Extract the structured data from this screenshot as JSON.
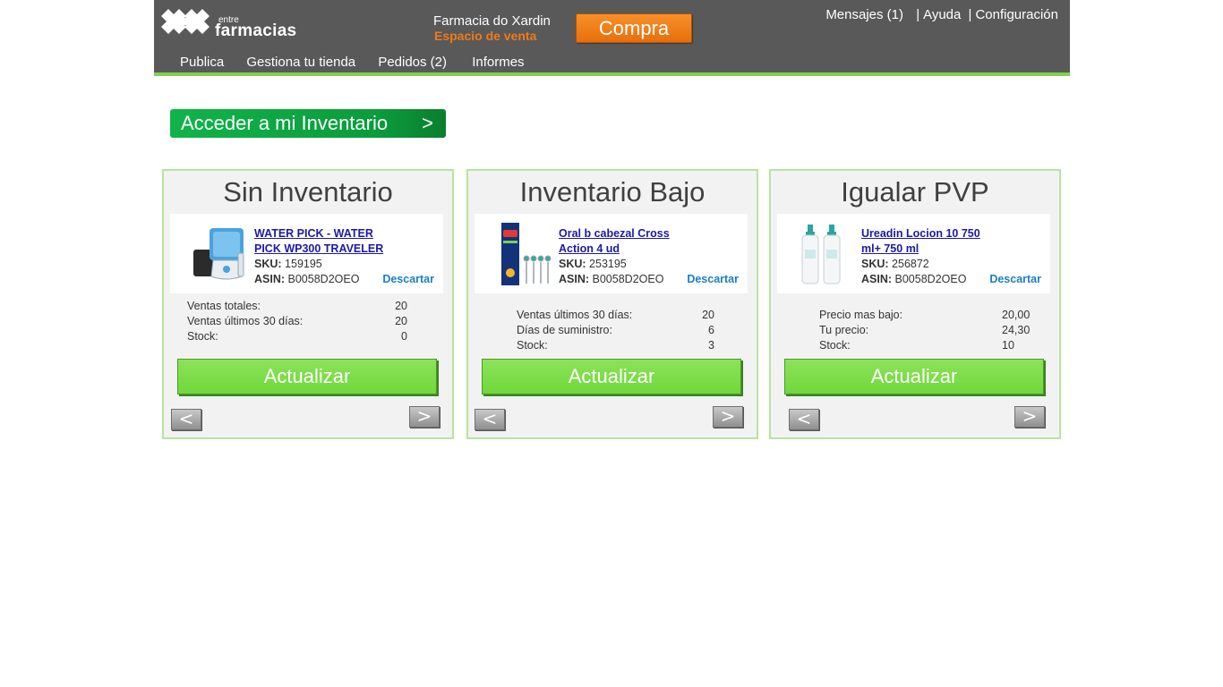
{
  "header": {
    "logo_small": "entre",
    "logo_big": "farmacias",
    "store_name": "Farmacia do Xardin",
    "store_subtitle": "Espacio de venta",
    "compra_label": "Compra",
    "links": {
      "mensajes": "Mensajes (1)",
      "ayuda": "Ayuda",
      "configuracion": "Configuración",
      "separator": "|"
    },
    "nav": [
      "Publica",
      "Gestiona tu tienda",
      "Pedidos (2)",
      "Informes"
    ],
    "accent_color": "#7fd04f",
    "bg_color": "#595959"
  },
  "inventory_button": {
    "label": "Acceder a mi Inventario",
    "arrow": ">"
  },
  "panels": [
    {
      "title": "Sin Inventario",
      "product": {
        "name": "WATER PICK - WATER PICK WP300 TRAVELER",
        "sku_label": "SKU:",
        "sku": "159195",
        "asin_label": "ASIN:",
        "asin": "B0058D2OEO",
        "image_icon": "water-flosser-icon"
      },
      "discard": "Descartar",
      "stats": [
        {
          "label": "Ventas totales:",
          "value": "20"
        },
        {
          "label": "Ventas últimos 30 días:",
          "value": "20"
        },
        {
          "label": "Stock:",
          "value": "0"
        }
      ],
      "update": "Actualizar",
      "prev": "<",
      "next": ">"
    },
    {
      "title": "Inventario Bajo",
      "product": {
        "name": "Oral b cabezal Cross Action 4 ud",
        "sku_label": "SKU:",
        "sku": "253195",
        "asin_label": "ASIN:",
        "asin": "B0058D2OEO",
        "image_icon": "toothbrush-heads-icon"
      },
      "discard": "Descartar",
      "stats": [
        {
          "label": "Ventas últimos 30 días:",
          "value": "20"
        },
        {
          "label": "Días de suministro:",
          "value": "6"
        },
        {
          "label": "Stock:",
          "value": "3"
        }
      ],
      "update": "Actualizar",
      "prev": "<",
      "next": ">"
    },
    {
      "title": "Igualar PVP",
      "product": {
        "name": "Ureadin Locion 10 750 ml+ 750 ml",
        "sku_label": "SKU:",
        "sku": "256872",
        "asin_label": "ASIN:",
        "asin": "B0058D2OEO",
        "image_icon": "lotion-bottles-icon"
      },
      "discard": "Descartar",
      "stats": [
        {
          "label": "Precio mas bajo:",
          "value": "20,00"
        },
        {
          "label": "Tu precio:",
          "value": "24,30"
        },
        {
          "label": "Stock:",
          "value": "10"
        }
      ],
      "update": "Actualizar",
      "prev": "<",
      "next": ">"
    }
  ]
}
